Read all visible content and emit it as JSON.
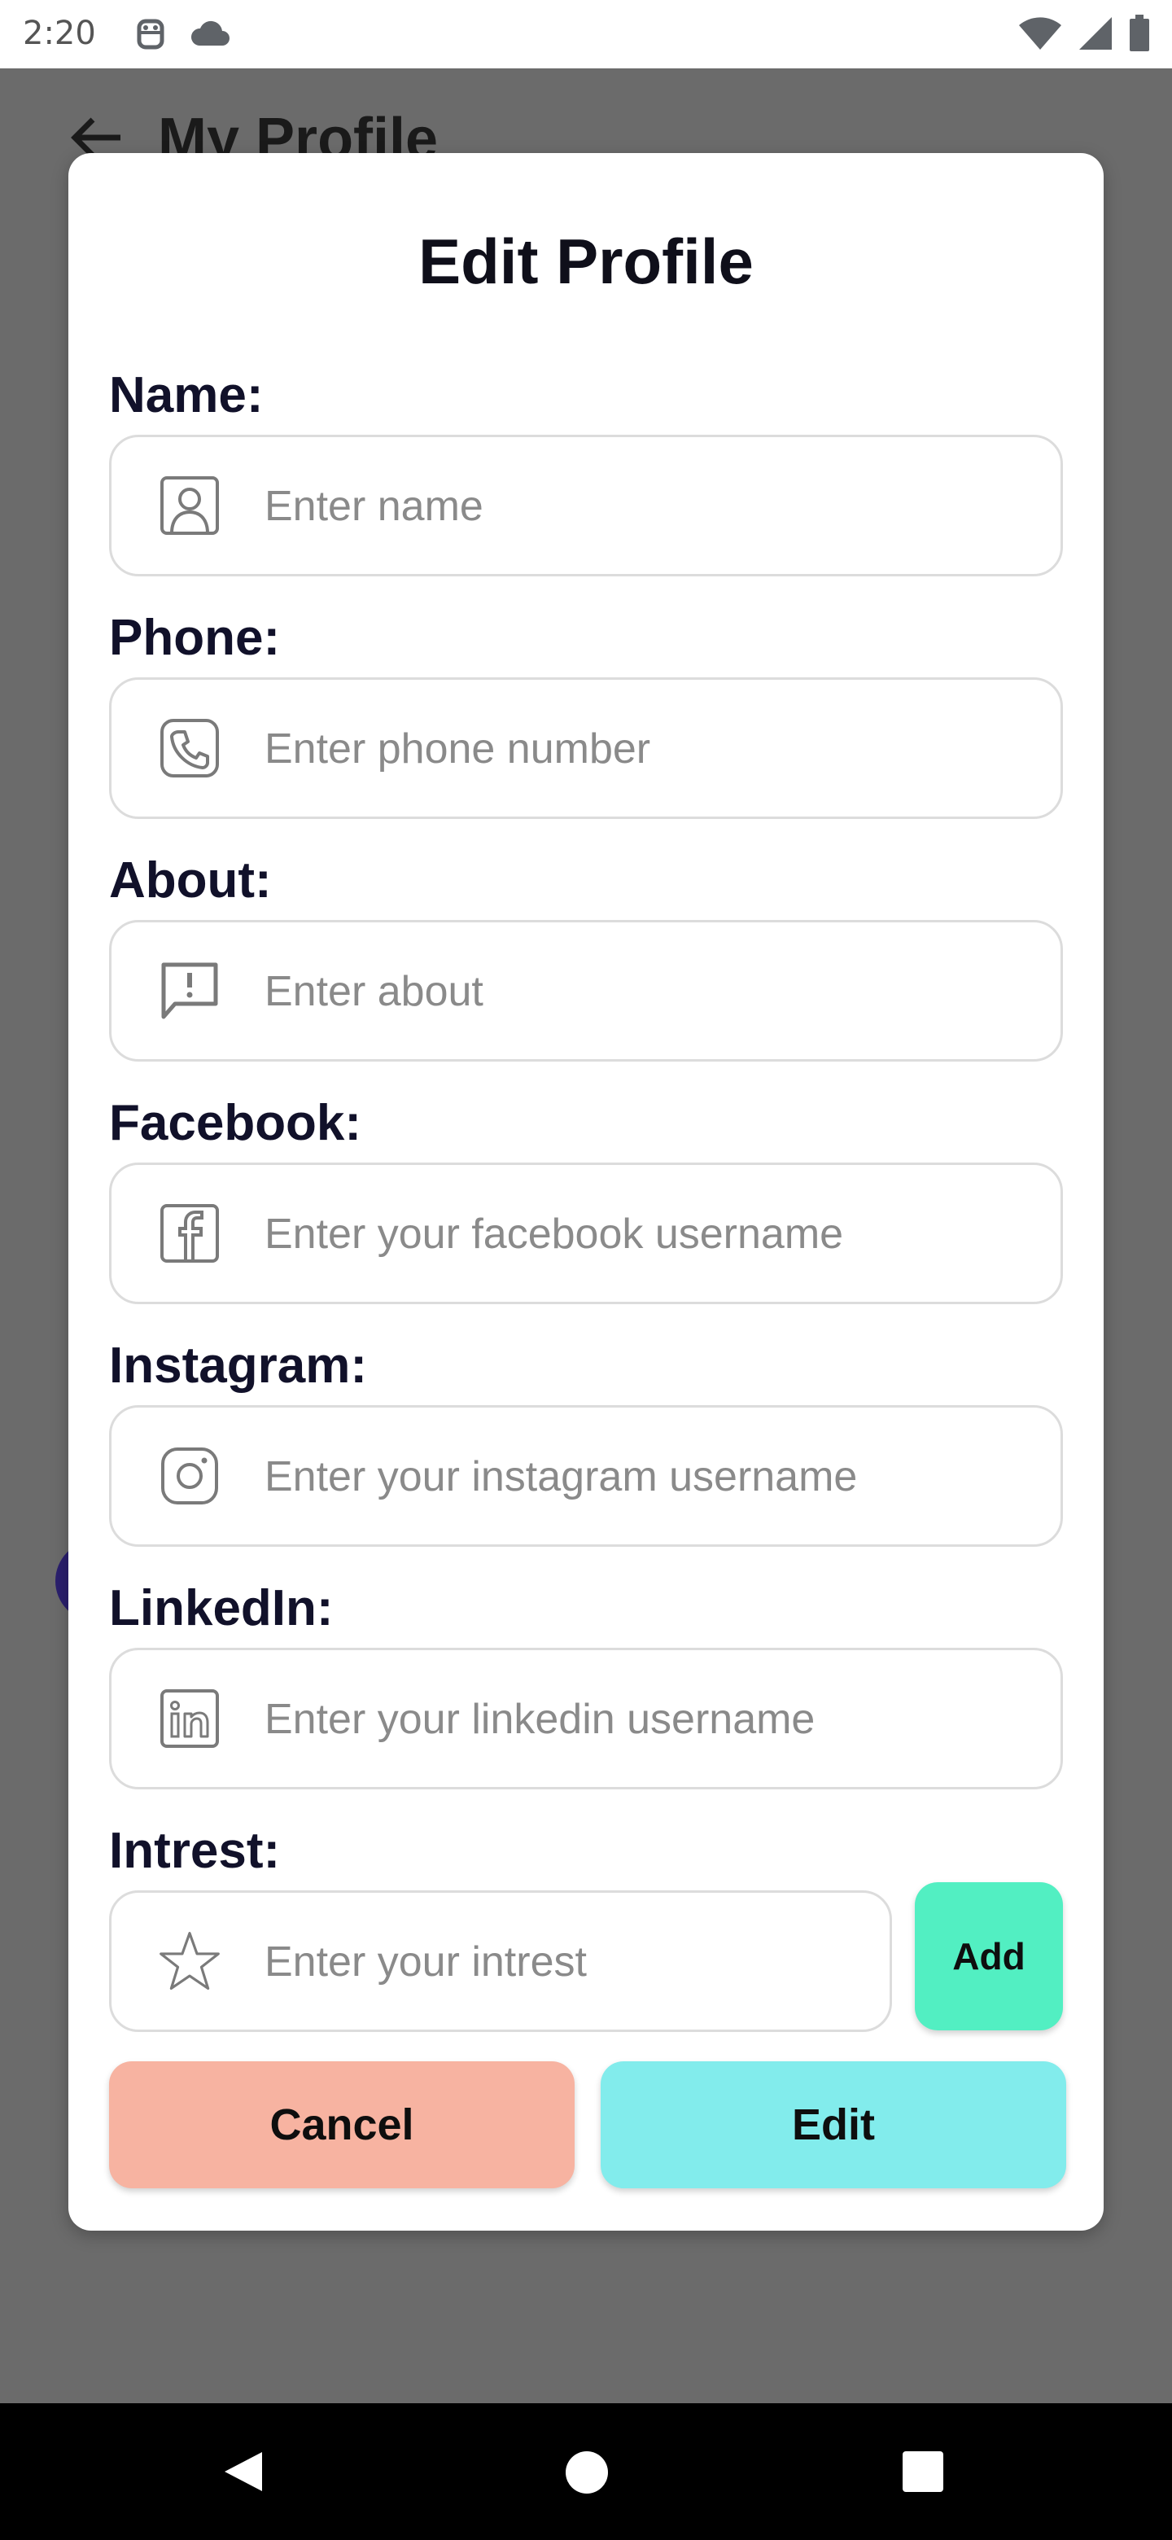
{
  "status_bar": {
    "time": "2:20",
    "left_icons": [
      "android-debug-icon",
      "cloud-icon"
    ],
    "right_icons": [
      "wifi-icon",
      "cellular-signal-icon",
      "battery-icon"
    ]
  },
  "background": {
    "title": "My Profile"
  },
  "dialog": {
    "title": "Edit Profile",
    "fields": [
      {
        "label": "Name:",
        "placeholder": "Enter name",
        "icon": "person-icon"
      },
      {
        "label": "Phone:",
        "placeholder": "Enter phone number",
        "icon": "phone-icon"
      },
      {
        "label": "About:",
        "placeholder": "Enter about",
        "icon": "message-info-icon"
      },
      {
        "label": "Facebook:",
        "placeholder": "Enter your facebook username",
        "icon": "facebook-icon"
      },
      {
        "label": "Instagram:",
        "placeholder": "Enter your instagram username",
        "icon": "instagram-icon"
      },
      {
        "label": "LinkedIn:",
        "placeholder": "Enter your linkedin username",
        "icon": "linkedin-icon"
      },
      {
        "label": "Intrest:",
        "placeholder": "Enter your intrest",
        "icon": "star-icon"
      }
    ],
    "add_label": "Add",
    "cancel_label": "Cancel",
    "edit_label": "Edit"
  },
  "colors": {
    "add": "#52efc2",
    "cancel": "#f7b3a1",
    "edit": "#82ecec"
  }
}
